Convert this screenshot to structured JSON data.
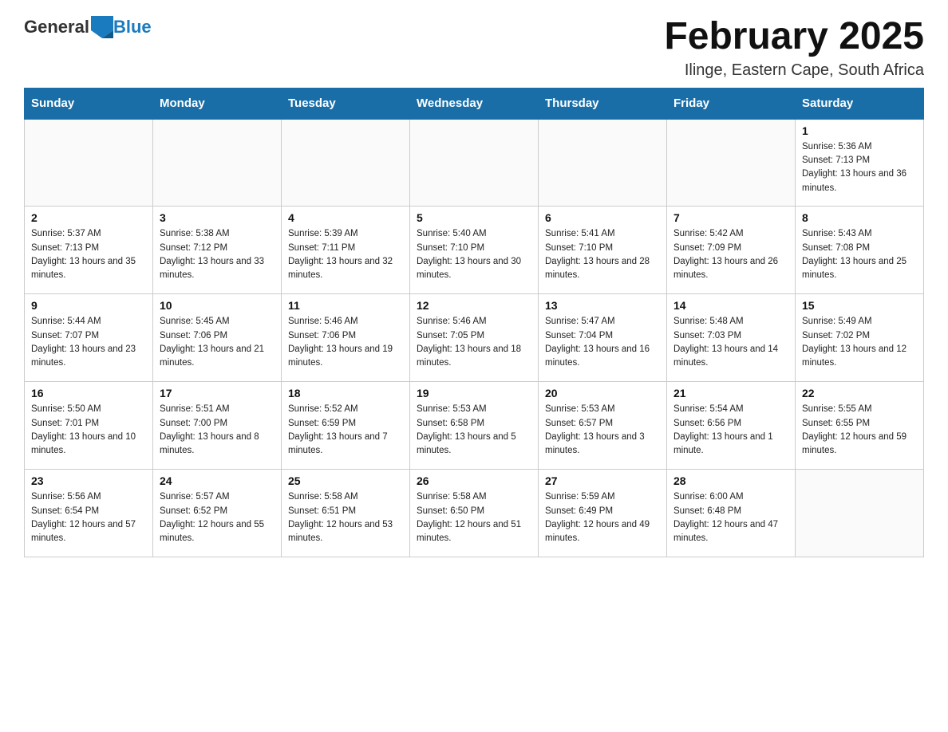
{
  "header": {
    "logo": {
      "general": "General",
      "blue": "Blue"
    },
    "title": "February 2025",
    "location": "Ilinge, Eastern Cape, South Africa"
  },
  "weekdays": [
    "Sunday",
    "Monday",
    "Tuesday",
    "Wednesday",
    "Thursday",
    "Friday",
    "Saturday"
  ],
  "weeks": [
    [
      {
        "day": "",
        "info": ""
      },
      {
        "day": "",
        "info": ""
      },
      {
        "day": "",
        "info": ""
      },
      {
        "day": "",
        "info": ""
      },
      {
        "day": "",
        "info": ""
      },
      {
        "day": "",
        "info": ""
      },
      {
        "day": "1",
        "info": "Sunrise: 5:36 AM\nSunset: 7:13 PM\nDaylight: 13 hours and 36 minutes."
      }
    ],
    [
      {
        "day": "2",
        "info": "Sunrise: 5:37 AM\nSunset: 7:13 PM\nDaylight: 13 hours and 35 minutes."
      },
      {
        "day": "3",
        "info": "Sunrise: 5:38 AM\nSunset: 7:12 PM\nDaylight: 13 hours and 33 minutes."
      },
      {
        "day": "4",
        "info": "Sunrise: 5:39 AM\nSunset: 7:11 PM\nDaylight: 13 hours and 32 minutes."
      },
      {
        "day": "5",
        "info": "Sunrise: 5:40 AM\nSunset: 7:10 PM\nDaylight: 13 hours and 30 minutes."
      },
      {
        "day": "6",
        "info": "Sunrise: 5:41 AM\nSunset: 7:10 PM\nDaylight: 13 hours and 28 minutes."
      },
      {
        "day": "7",
        "info": "Sunrise: 5:42 AM\nSunset: 7:09 PM\nDaylight: 13 hours and 26 minutes."
      },
      {
        "day": "8",
        "info": "Sunrise: 5:43 AM\nSunset: 7:08 PM\nDaylight: 13 hours and 25 minutes."
      }
    ],
    [
      {
        "day": "9",
        "info": "Sunrise: 5:44 AM\nSunset: 7:07 PM\nDaylight: 13 hours and 23 minutes."
      },
      {
        "day": "10",
        "info": "Sunrise: 5:45 AM\nSunset: 7:06 PM\nDaylight: 13 hours and 21 minutes."
      },
      {
        "day": "11",
        "info": "Sunrise: 5:46 AM\nSunset: 7:06 PM\nDaylight: 13 hours and 19 minutes."
      },
      {
        "day": "12",
        "info": "Sunrise: 5:46 AM\nSunset: 7:05 PM\nDaylight: 13 hours and 18 minutes."
      },
      {
        "day": "13",
        "info": "Sunrise: 5:47 AM\nSunset: 7:04 PM\nDaylight: 13 hours and 16 minutes."
      },
      {
        "day": "14",
        "info": "Sunrise: 5:48 AM\nSunset: 7:03 PM\nDaylight: 13 hours and 14 minutes."
      },
      {
        "day": "15",
        "info": "Sunrise: 5:49 AM\nSunset: 7:02 PM\nDaylight: 13 hours and 12 minutes."
      }
    ],
    [
      {
        "day": "16",
        "info": "Sunrise: 5:50 AM\nSunset: 7:01 PM\nDaylight: 13 hours and 10 minutes."
      },
      {
        "day": "17",
        "info": "Sunrise: 5:51 AM\nSunset: 7:00 PM\nDaylight: 13 hours and 8 minutes."
      },
      {
        "day": "18",
        "info": "Sunrise: 5:52 AM\nSunset: 6:59 PM\nDaylight: 13 hours and 7 minutes."
      },
      {
        "day": "19",
        "info": "Sunrise: 5:53 AM\nSunset: 6:58 PM\nDaylight: 13 hours and 5 minutes."
      },
      {
        "day": "20",
        "info": "Sunrise: 5:53 AM\nSunset: 6:57 PM\nDaylight: 13 hours and 3 minutes."
      },
      {
        "day": "21",
        "info": "Sunrise: 5:54 AM\nSunset: 6:56 PM\nDaylight: 13 hours and 1 minute."
      },
      {
        "day": "22",
        "info": "Sunrise: 5:55 AM\nSunset: 6:55 PM\nDaylight: 12 hours and 59 minutes."
      }
    ],
    [
      {
        "day": "23",
        "info": "Sunrise: 5:56 AM\nSunset: 6:54 PM\nDaylight: 12 hours and 57 minutes."
      },
      {
        "day": "24",
        "info": "Sunrise: 5:57 AM\nSunset: 6:52 PM\nDaylight: 12 hours and 55 minutes."
      },
      {
        "day": "25",
        "info": "Sunrise: 5:58 AM\nSunset: 6:51 PM\nDaylight: 12 hours and 53 minutes."
      },
      {
        "day": "26",
        "info": "Sunrise: 5:58 AM\nSunset: 6:50 PM\nDaylight: 12 hours and 51 minutes."
      },
      {
        "day": "27",
        "info": "Sunrise: 5:59 AM\nSunset: 6:49 PM\nDaylight: 12 hours and 49 minutes."
      },
      {
        "day": "28",
        "info": "Sunrise: 6:00 AM\nSunset: 6:48 PM\nDaylight: 12 hours and 47 minutes."
      },
      {
        "day": "",
        "info": ""
      }
    ]
  ]
}
